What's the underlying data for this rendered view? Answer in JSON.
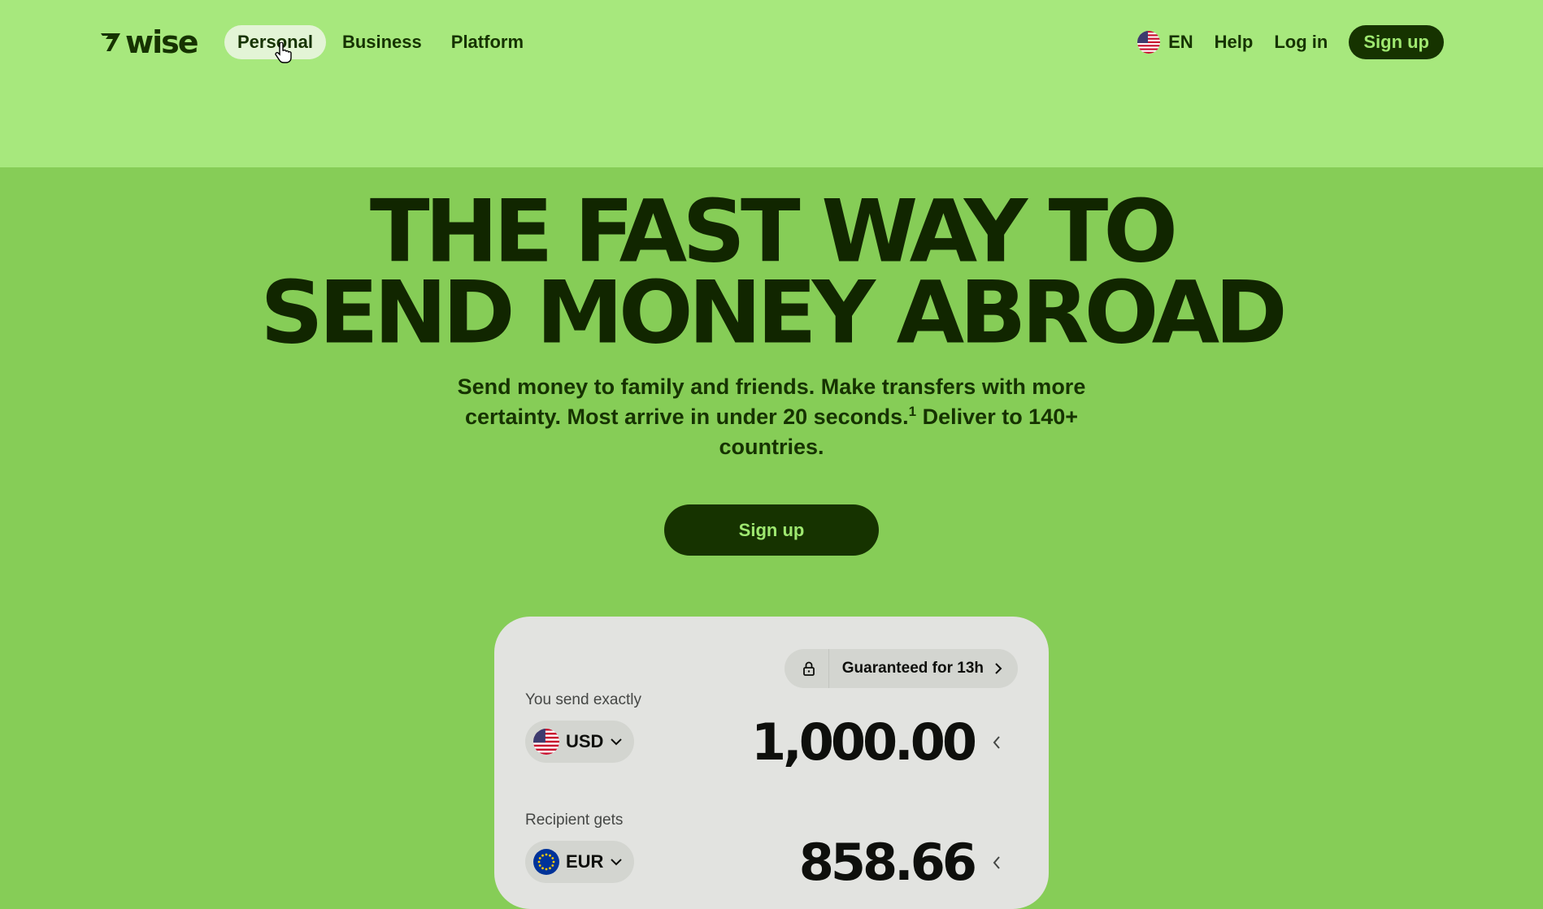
{
  "nav": {
    "logo": "wise",
    "items": [
      {
        "label": "Personal",
        "active": true
      },
      {
        "label": "Business",
        "active": false
      },
      {
        "label": "Platform",
        "active": false
      }
    ],
    "language": "EN",
    "help": "Help",
    "login": "Log in",
    "signup": "Sign up"
  },
  "hero": {
    "title_line1": "THE FAST WAY TO",
    "title_line2": "SEND MONEY ABROAD",
    "subtitle_part1": "Send money to family and friends. Make transfers with more certainty. Most arrive in under 20 seconds.",
    "subtitle_footnote": "1",
    "subtitle_part2": " Deliver to 140+ countries.",
    "cta": "Sign up"
  },
  "calculator": {
    "guarantee": "Guaranteed for 13h",
    "send_label": "You send exactly",
    "send_currency": "USD",
    "send_amount": "1,000.00",
    "receive_label": "Recipient gets",
    "receive_currency": "EUR",
    "receive_amount": "858.66"
  },
  "colors": {
    "brand_green": "#9fe870",
    "forest_green": "#163300",
    "hero_background": "#86cd57"
  }
}
